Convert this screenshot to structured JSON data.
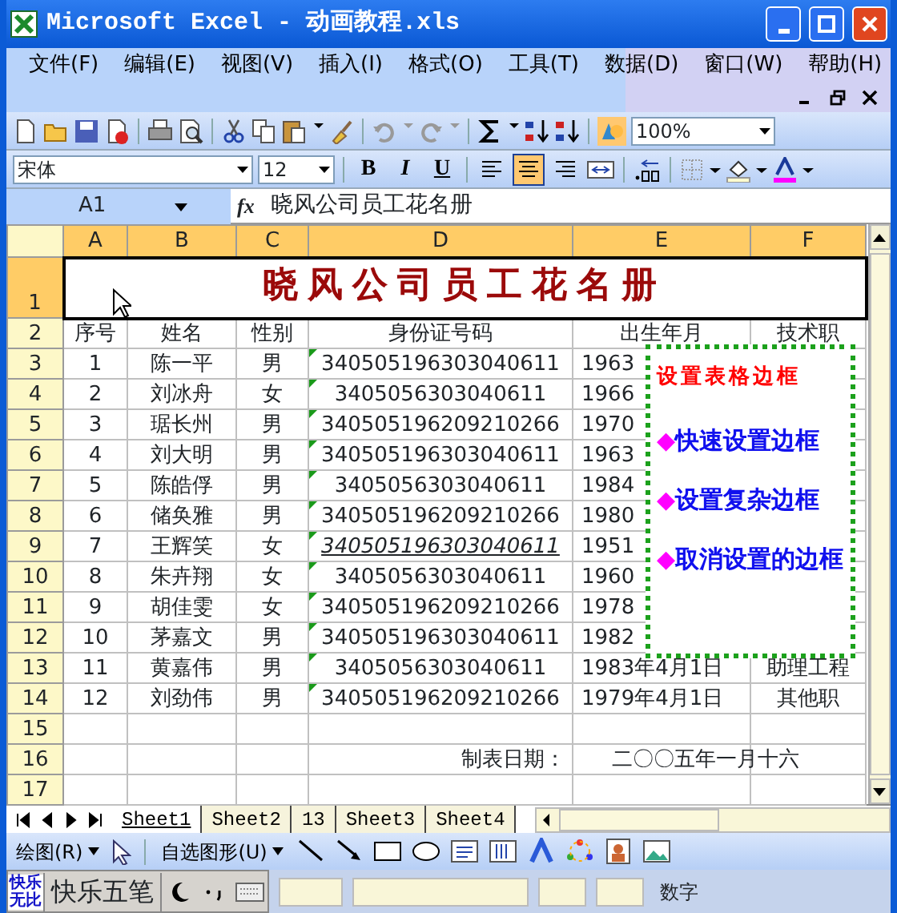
{
  "window": {
    "title": "Microsoft Excel - 动画教程.xls"
  },
  "menu": [
    "文件(F)",
    "编辑(E)",
    "视图(V)",
    "插入(I)",
    "格式(O)",
    "工具(T)",
    "数据(D)",
    "窗口(W)",
    "帮助(H)"
  ],
  "standard_toolbar": {
    "zoom": "100%"
  },
  "formatting_toolbar": {
    "font": "宋体",
    "size": "12",
    "styles": [
      {
        "label": "B",
        "kind": "bold"
      },
      {
        "label": "I",
        "kind": "italic"
      },
      {
        "label": "U",
        "kind": "underline"
      }
    ],
    "alignment": [
      {
        "kind": "left",
        "selected": false
      },
      {
        "kind": "center",
        "selected": true
      },
      {
        "kind": "right",
        "selected": false
      }
    ]
  },
  "formula_bar": {
    "name_box": "A1",
    "fx": "fx",
    "formula": "晓风公司员工花名册"
  },
  "sheet": {
    "columns": [
      {
        "label": "A",
        "selected": true
      },
      {
        "label": "B",
        "selected": true
      },
      {
        "label": "C",
        "selected": true
      },
      {
        "label": "D",
        "selected": true
      },
      {
        "label": "E",
        "selected": true
      },
      {
        "label": "F",
        "selected": true
      }
    ],
    "rows": [
      {
        "number": "1",
        "selected": true,
        "title": "晓风公司员工花名册"
      },
      {
        "number": "2",
        "selected": false,
        "A": "序号",
        "B": "姓名",
        "C": "性别",
        "D": "身份证号码",
        "E": "出生年月",
        "F": "技术职"
      },
      {
        "number": "3",
        "selected": false,
        "A": "1",
        "B": "陈一平",
        "C": "男",
        "D": "340505196303040611",
        "E": "1963",
        "error_mark": true,
        "emphasized": false
      },
      {
        "number": "4",
        "selected": false,
        "A": "2",
        "B": "刘冰舟",
        "C": "女",
        "D": "3405056303040611",
        "E": "1966",
        "error_mark": true,
        "emphasized": false
      },
      {
        "number": "5",
        "selected": false,
        "A": "3",
        "B": "琚长州",
        "C": "男",
        "D": "340505196209210266",
        "E": "1970",
        "error_mark": true,
        "emphasized": false
      },
      {
        "number": "6",
        "selected": false,
        "A": "4",
        "B": "刘大明",
        "C": "男",
        "D": "340505196303040611",
        "E": "1963",
        "error_mark": true,
        "emphasized": false
      },
      {
        "number": "7",
        "selected": false,
        "A": "5",
        "B": "陈皓俘",
        "C": "男",
        "D": "3405056303040611",
        "E": "1984",
        "error_mark": true,
        "emphasized": false
      },
      {
        "number": "8",
        "selected": false,
        "A": "6",
        "B": "储奂雅",
        "C": "男",
        "D": "340505196209210266",
        "E": "1980",
        "error_mark": true,
        "emphasized": false
      },
      {
        "number": "9",
        "selected": false,
        "A": "7",
        "B": "王辉笑",
        "C": "女",
        "D": "340505196303040611",
        "E": "1951",
        "error_mark": true,
        "emphasized": true
      },
      {
        "number": "10",
        "selected": false,
        "A": "8",
        "B": "朱卉翔",
        "C": "女",
        "D": "3405056303040611",
        "E": "1960",
        "error_mark": true,
        "emphasized": false
      },
      {
        "number": "11",
        "selected": false,
        "A": "9",
        "B": "胡佳雯",
        "C": "女",
        "D": "340505196209210266",
        "E": "1978",
        "error_mark": true,
        "emphasized": false
      },
      {
        "number": "12",
        "selected": false,
        "A": "10",
        "B": "茅嘉文",
        "C": "男",
        "D": "340505196303040611",
        "E": "1982",
        "error_mark": true,
        "emphasized": false
      },
      {
        "number": "13",
        "selected": false,
        "A": "11",
        "B": "黄嘉伟",
        "C": "男",
        "D": "3405056303040611",
        "E": "1983年4月1日",
        "F": "助理工程",
        "error_mark": true,
        "emphasized": false
      },
      {
        "number": "14",
        "selected": false,
        "A": "12",
        "B": "刘劲伟",
        "C": "男",
        "D": "340505196209210266",
        "E": "1979年4月1日",
        "F": "其他职",
        "error_mark": true,
        "emphasized": false
      },
      {
        "number": "15",
        "selected": false
      },
      {
        "number": "16",
        "selected": false,
        "D": "制表日期：",
        "E": "二〇〇五年一月十六"
      },
      {
        "number": "17",
        "selected": false
      }
    ]
  },
  "text_box": {
    "title": "设置表格边框",
    "items": [
      {
        "bullet": "◆",
        "label": "快速设置边框"
      },
      {
        "bullet": "◆",
        "label": "设置复杂边框"
      },
      {
        "bullet": "◆",
        "label": "取消设置的边框"
      }
    ]
  },
  "sheet_tabs": [
    {
      "label": "Sheet1",
      "selected": true
    },
    {
      "label": "Sheet2",
      "selected": false
    },
    {
      "label": "13",
      "selected": false
    },
    {
      "label": "Sheet3",
      "selected": false
    },
    {
      "label": "Sheet4",
      "selected": false
    }
  ],
  "drawing_toolbar": {
    "draw_menu": "绘图(R)",
    "autoshapes": "自选图形(U)"
  },
  "input_method": {
    "logo": "快乐无比",
    "name": "快乐五笔"
  },
  "status_bar": {
    "indicator": "数字"
  }
}
